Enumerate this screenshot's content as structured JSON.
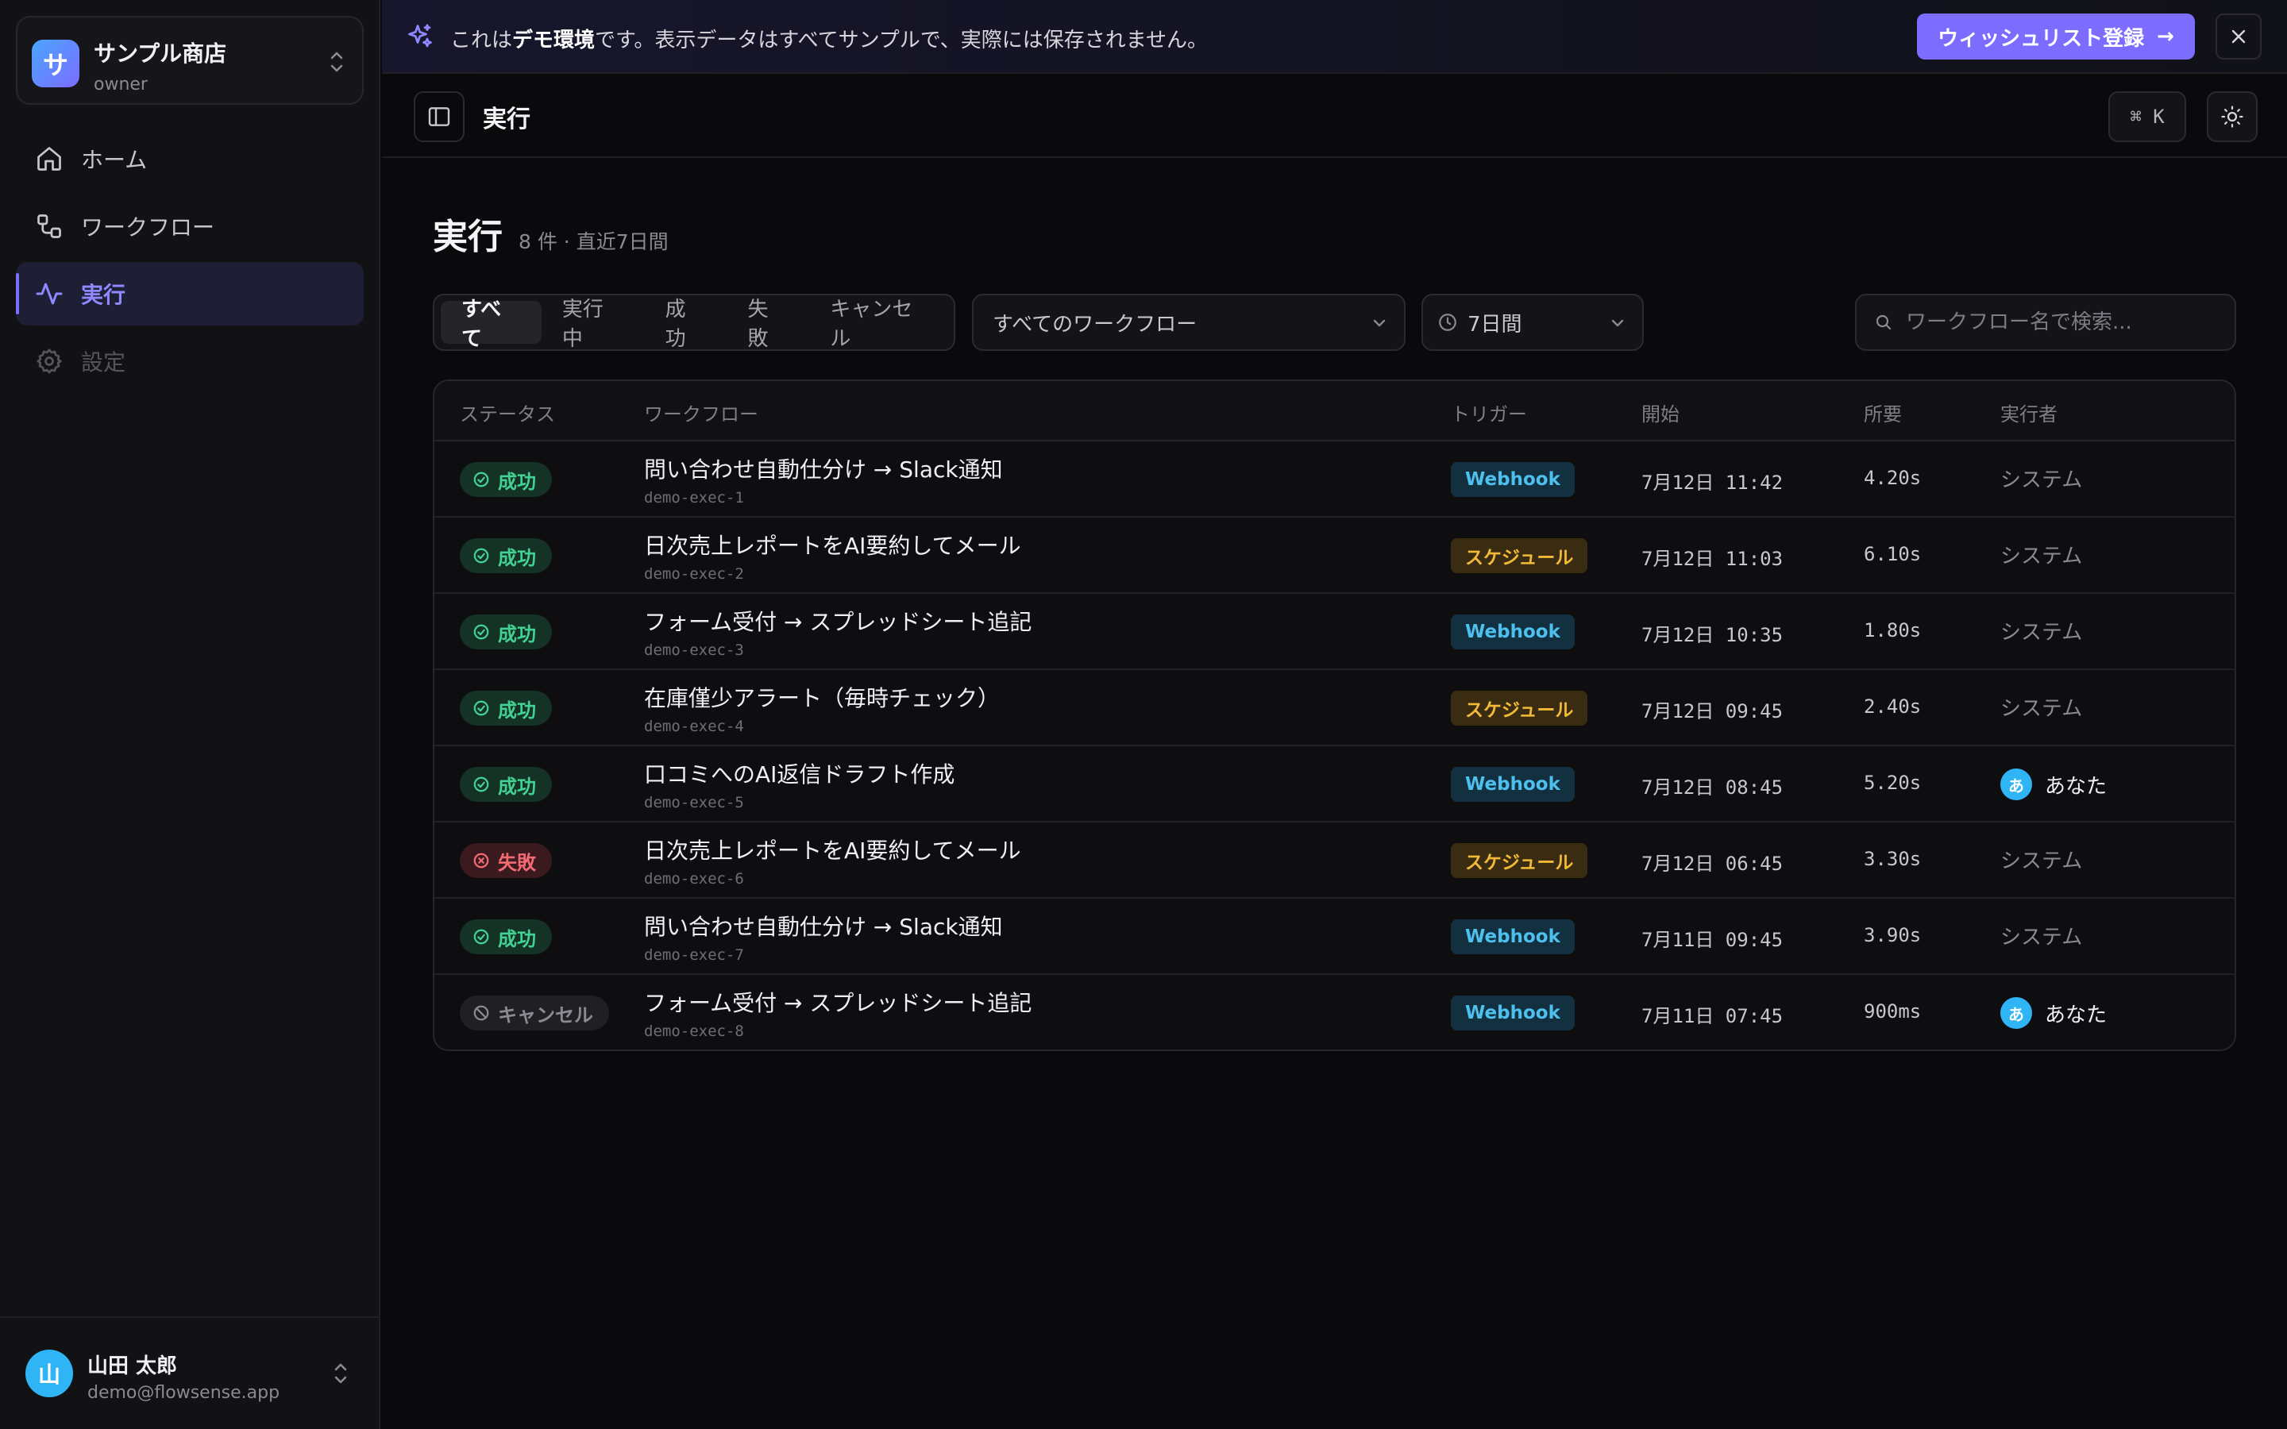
{
  "store": {
    "avatar": "サ",
    "name": "サンプル商店",
    "role": "owner"
  },
  "nav": [
    {
      "label": "ホーム",
      "icon": "home-icon",
      "state": "normal"
    },
    {
      "label": "ワークフロー",
      "icon": "workflow-icon",
      "state": "normal"
    },
    {
      "label": "実行",
      "icon": "activity-icon",
      "state": "active"
    },
    {
      "label": "設定",
      "icon": "gear-icon",
      "state": "disabled"
    }
  ],
  "user": {
    "avatar": "山",
    "name": "山田 太郎",
    "email": "demo@flowsense.app"
  },
  "banner": {
    "prefix": "これは",
    "bold": "デモ環境",
    "suffix": "です。表示データはすべてサンプルで、実際には保存されません。",
    "cta": "ウィッシュリスト登録",
    "cta_arrow": "→"
  },
  "topbar": {
    "title": "実行",
    "shortcut": "⌘ K"
  },
  "heading": {
    "title": "実行",
    "meta": "8 件 · 直近7日間"
  },
  "filters": {
    "segments": [
      "すべて",
      "実行中",
      "成功",
      "失敗",
      "キャンセル"
    ],
    "active_segment": 0,
    "workflow_select": "すべてのワークフロー",
    "period_select": "7日間",
    "search_placeholder": "ワークフロー名で検索..."
  },
  "table": {
    "headers": {
      "status": "ステータス",
      "workflow": "ワークフロー",
      "trigger": "トリガー",
      "start": "開始",
      "duration": "所要",
      "actor": "実行者"
    },
    "rows": [
      {
        "status": "成功",
        "status_type": "success",
        "name": "問い合わせ自動仕分け → Slack通知",
        "id": "demo-exec-1",
        "trigger": "Webhook",
        "trigger_type": "webhook",
        "start": "7月12日 11:42",
        "duration": "4.20s",
        "actor": "システム",
        "actor_avatar": ""
      },
      {
        "status": "成功",
        "status_type": "success",
        "name": "日次売上レポートをAI要約してメール",
        "id": "demo-exec-2",
        "trigger": "スケジュール",
        "trigger_type": "schedule",
        "start": "7月12日 11:03",
        "duration": "6.10s",
        "actor": "システム",
        "actor_avatar": ""
      },
      {
        "status": "成功",
        "status_type": "success",
        "name": "フォーム受付 → スプレッドシート追記",
        "id": "demo-exec-3",
        "trigger": "Webhook",
        "trigger_type": "webhook",
        "start": "7月12日 10:35",
        "duration": "1.80s",
        "actor": "システム",
        "actor_avatar": ""
      },
      {
        "status": "成功",
        "status_type": "success",
        "name": "在庫僅少アラート（毎時チェック）",
        "id": "demo-exec-4",
        "trigger": "スケジュール",
        "trigger_type": "schedule",
        "start": "7月12日 09:45",
        "duration": "2.40s",
        "actor": "システム",
        "actor_avatar": ""
      },
      {
        "status": "成功",
        "status_type": "success",
        "name": "口コミへのAI返信ドラフト作成",
        "id": "demo-exec-5",
        "trigger": "Webhook",
        "trigger_type": "webhook",
        "start": "7月12日 08:45",
        "duration": "5.20s",
        "actor": "あなた",
        "actor_avatar": "あ"
      },
      {
        "status": "失敗",
        "status_type": "failed",
        "name": "日次売上レポートをAI要約してメール",
        "id": "demo-exec-6",
        "trigger": "スケジュール",
        "trigger_type": "schedule",
        "start": "7月12日 06:45",
        "duration": "3.30s",
        "actor": "システム",
        "actor_avatar": ""
      },
      {
        "status": "成功",
        "status_type": "success",
        "name": "問い合わせ自動仕分け → Slack通知",
        "id": "demo-exec-7",
        "trigger": "Webhook",
        "trigger_type": "webhook",
        "start": "7月11日 09:45",
        "duration": "3.90s",
        "actor": "システム",
        "actor_avatar": ""
      },
      {
        "status": "キャンセル",
        "status_type": "cancel",
        "name": "フォーム受付 → スプレッドシート追記",
        "id": "demo-exec-8",
        "trigger": "Webhook",
        "trigger_type": "webhook",
        "start": "7月11日 07:45",
        "duration": "900ms",
        "actor": "あなた",
        "actor_avatar": "あ"
      }
    ]
  },
  "colors": {
    "accent": "#7c6cff",
    "success": "#41d393",
    "failed": "#f26a72",
    "webhook": "#4ec0ee",
    "schedule": "#f2b93a",
    "avatar": "#2fb4f5"
  }
}
